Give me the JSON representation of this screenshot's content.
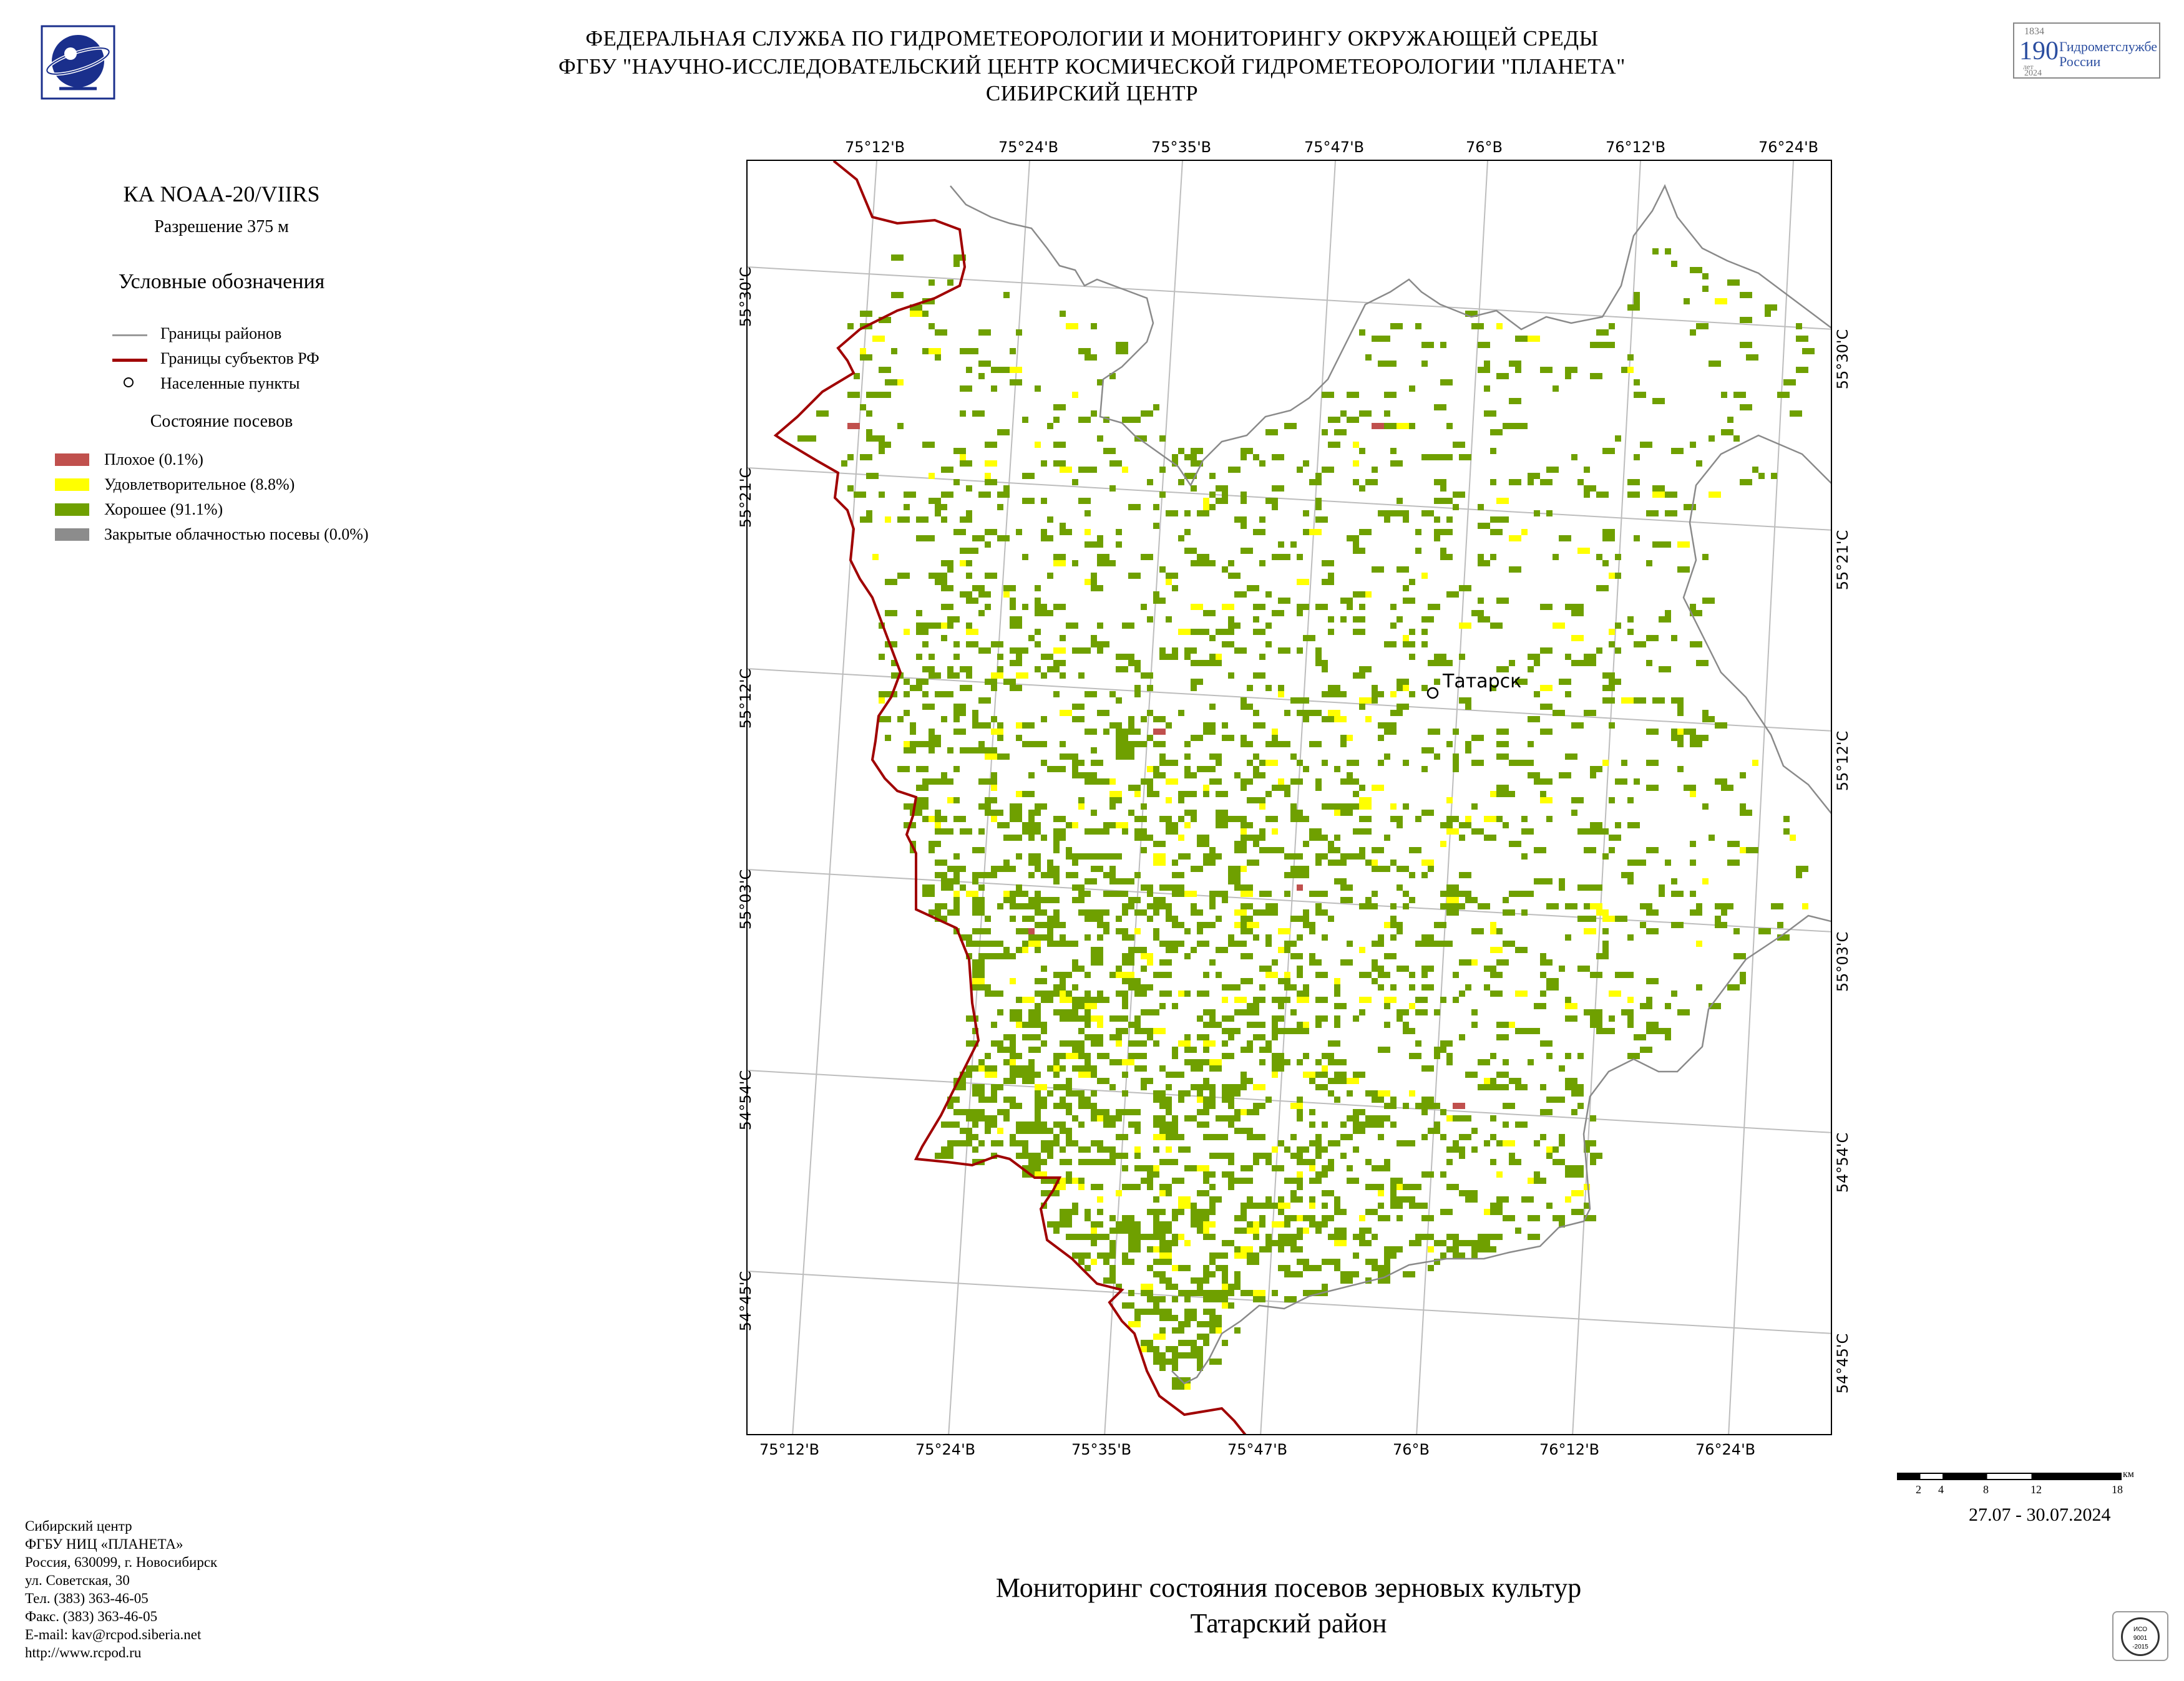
{
  "header": {
    "line1": "ФЕДЕРАЛЬНАЯ СЛУЖБА ПО ГИДРОМЕТЕОРОЛОГИИ И МОНИТОРИНГУ ОКРУЖАЮЩЕЙ СРЕДЫ",
    "line2": "ФГБУ \"НАУЧНО-ИССЛЕДОВАТЕЛЬСКИЙ ЦЕНТР КОСМИЧЕСКОЙ ГИДРОМЕТЕОРОЛОГИИ \"ПЛАНЕТА\"",
    "line3": "СИБИРСКИЙ ЦЕНТР"
  },
  "badge": {
    "year_top": "1834",
    "number": "190",
    "unit": "лет",
    "year_bottom": "2024",
    "text1": "Гидрометслужбе",
    "text2": "России"
  },
  "sidebar": {
    "satellite": "КА NOAA-20/VIIRS",
    "resolution": "Разрешение 375 м",
    "legend_title": "Условные обозначения",
    "boundaries": [
      {
        "label": "Границы районов",
        "color": "#999999"
      },
      {
        "label": "Границы субъектов РФ",
        "color": "#a00000"
      },
      {
        "label": "Населенные пункты"
      }
    ],
    "crop_title": "Состояние посевов",
    "classes": [
      {
        "label": "Плохое (0.1%)",
        "color": "#c0504d"
      },
      {
        "label": "Удовлетворительное (8.8%)",
        "color": "#ffff00"
      },
      {
        "label": "Хорошее (91.1%)",
        "color": "#6fa000"
      },
      {
        "label": "Закрытые облачностью посевы (0.0%)",
        "color": "#8c8c8c"
      }
    ]
  },
  "map": {
    "top_ticks": [
      "75°12'В",
      "75°24'В",
      "75°35'В",
      "75°47'В",
      "76°В",
      "76°12'В",
      "76°24'В"
    ],
    "bottom_ticks": [
      "75°12'В",
      "75°24'В",
      "75°35'В",
      "75°47'В",
      "76°В",
      "76°12'В",
      "76°24'В"
    ],
    "left_ticks": [
      "55°30'С",
      "55°21'С",
      "55°12'С",
      "55°03'С",
      "54°54'С",
      "54°45'С"
    ],
    "right_ticks": [
      "55°30'С",
      "55°21'С",
      "55°12'С",
      "55°03'С",
      "54°54'С",
      "54°45'С"
    ],
    "settlement": "Татарск"
  },
  "scale": {
    "labels": [
      "2",
      "4",
      "8",
      "12",
      "18"
    ],
    "unit": "км"
  },
  "date_range": "27.07 - 30.07.2024",
  "title": {
    "line1": "Мониторинг состояния посевов зерновых культур",
    "line2": "Татарский район"
  },
  "footer": [
    "Сибирский центр",
    "ФГБУ НИЦ «ПЛАНЕТА»",
    "Россия, 630099, г. Новосибирск",
    "ул. Советская, 30",
    "Тел. (383) 363-46-05",
    "Факс. (383) 363-46-05",
    "E-mail: kav@rcpod.siberia.net",
    "http://www.rcpod.ru"
  ],
  "iso_badge": {
    "line1": "ИСО",
    "line2": "9001",
    "line3": "-2015"
  }
}
